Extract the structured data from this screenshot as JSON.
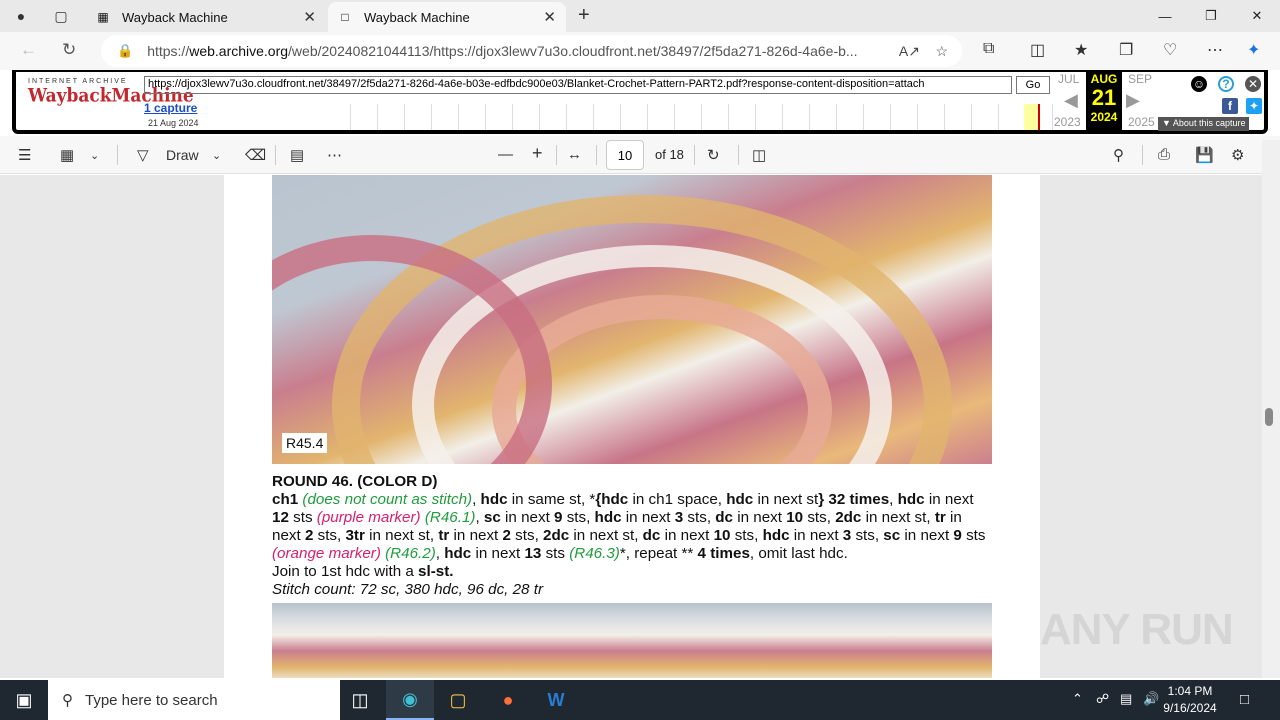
{
  "browser": {
    "tabs": [
      {
        "title": "Wayback Machine",
        "active": false
      },
      {
        "title": "Wayback Machine",
        "active": true
      }
    ],
    "url_prefix": "https://",
    "url_domain": "web.archive.org",
    "url_rest": "/web/20240821044113/https://djox3lewv7u3o.cloudfront.net/38497/2f5da271-826d-4a6e-b..."
  },
  "wayback": {
    "logo_top": "INTERNET ARCHIVE",
    "logo_main": "WaybackMachine",
    "input_url": "https://djox3lewv7u3o.cloudfront.net/38497/2f5da271-826d-4a6e-b03e-edfbdc900e03/Blanket-Crochet-Pattern-PART2.pdf?response-content-disposition=attach",
    "go_label": "Go",
    "captures": "1 capture",
    "capture_date": "21 Aug 2024",
    "prev_month": "JUL",
    "cur_month": "AUG",
    "next_month": "SEP",
    "cur_day": "21",
    "prev_year": "2023",
    "cur_year": "2024",
    "next_year": "2025",
    "about": "About this capture"
  },
  "pdf_toolbar": {
    "draw_label": "Draw",
    "page_current": "10",
    "page_total": "of 18"
  },
  "document": {
    "photo_label": "R45.4",
    "heading": "ROUND 46. (COLOR D)",
    "stitch_count": "Stitch count: 72 sc, 380 hdc, 96 dc, 28 tr",
    "join": "Join to 1st hdc with a ",
    "join_bold": "sl-st."
  },
  "watermark": "ANY RUN",
  "taskbar": {
    "search_placeholder": "Type here to search",
    "time": "1:04 PM",
    "date": "9/16/2024"
  },
  "colors": {
    "accent_green": "#1f9c3c",
    "accent_pink": "#d6206f",
    "wayback_red": "#c2272d"
  }
}
